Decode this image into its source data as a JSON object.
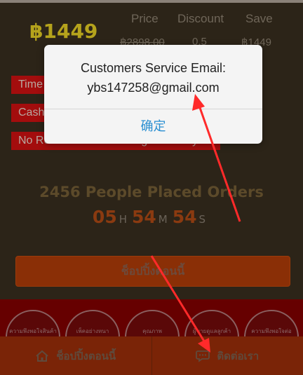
{
  "product": {
    "price": "฿1449",
    "stats": [
      {
        "label": "Price",
        "value": "฿2898.00"
      },
      {
        "label": "Discount",
        "value": "0.5"
      },
      {
        "label": "Save",
        "value": "฿1449"
      }
    ]
  },
  "tags": [
    "Time",
    "Cash",
    "No Reason Return/Change in 7 Days"
  ],
  "promo": {
    "orders_text": "2456 People Placed Orders",
    "countdown": {
      "hours": "05",
      "hours_unit": "H",
      "minutes": "54",
      "minutes_unit": "M",
      "seconds": "54",
      "seconds_unit": "S"
    }
  },
  "shop_button": {
    "label": "ช็อปปิ้งตอนนี้"
  },
  "strip_circles": [
    "ความพึงพอใจสินค้า",
    "เพ็คอย่างหนา",
    "คุณภาพ",
    "ผู้ขายดูแลลูกค้า",
    "ความพึงพอใจต่อสินค้า"
  ],
  "bottom_nav": {
    "shop_label": "ช็อปปิ้งตอนนี้",
    "contact_label": "ติดต่อเรา",
    "shop_icon": "home-icon",
    "contact_icon": "chat-icon"
  },
  "dialog": {
    "title": "Customers Service Email:",
    "email": "ybs147258@gmail.com",
    "ok_label": "确定"
  },
  "colors": {
    "background": "#2c2418",
    "price": "#b5a31c",
    "tag": "#a30d0d",
    "accent_button": "#8a2f06",
    "dialog_link": "#2a8fd1",
    "annotation_arrow": "#ff2a2a"
  }
}
